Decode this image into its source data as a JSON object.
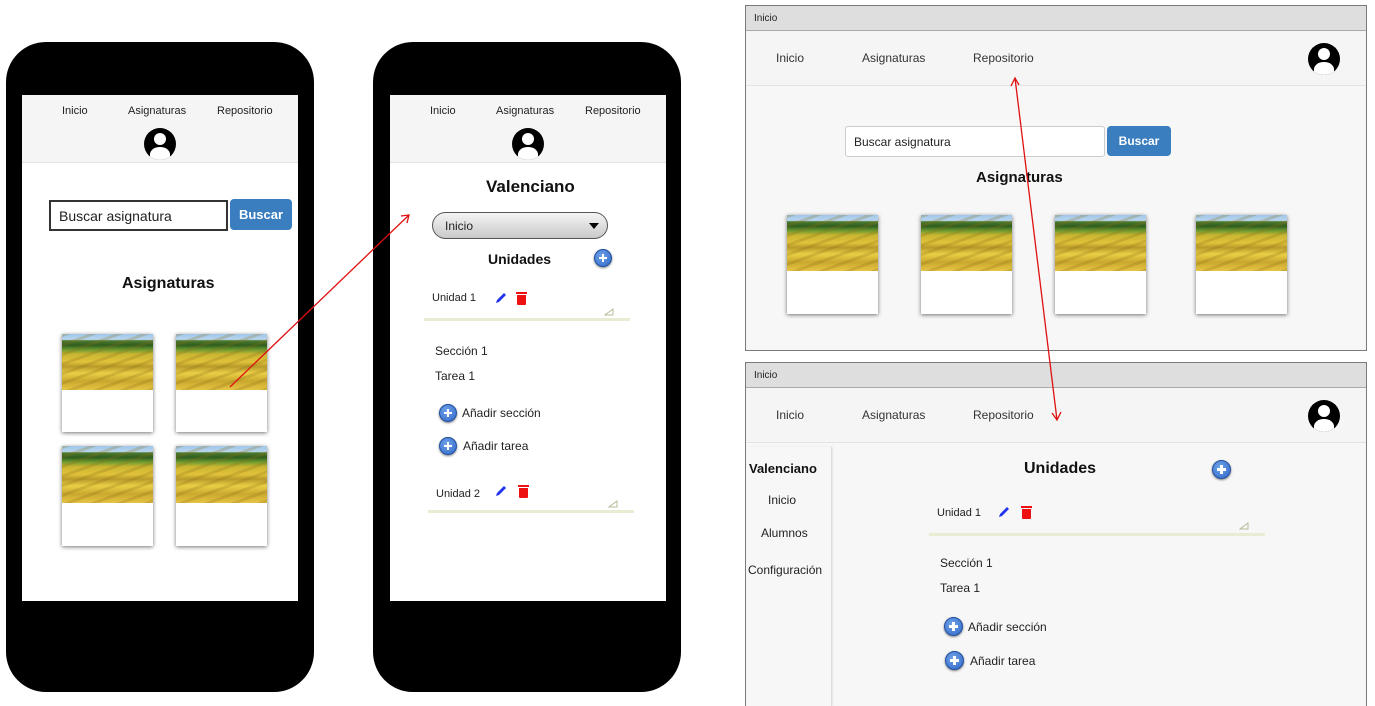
{
  "nav": {
    "inicio": "Inicio",
    "asignaturas": "Asignaturas",
    "repositorio": "Repositorio"
  },
  "search": {
    "placeholder": "Buscar asignatura",
    "button": "Buscar"
  },
  "home": {
    "title": "Asignaturas"
  },
  "course": {
    "title": "Valenciano",
    "select_value": "Inicio",
    "units_title": "Unidades",
    "unit1": "Unidad 1",
    "unit2": "Unidad 2",
    "section1": "Sección 1",
    "task1": "Tarea 1",
    "add_section": "Añadir sección",
    "add_task": "Añadir tarea"
  },
  "window": {
    "title_bar": "Inicio"
  },
  "sidebar": {
    "course": "Valenciano",
    "items": [
      "Inicio",
      "Alumnos",
      "Configuración"
    ]
  },
  "colors": {
    "primary_button": "#3a7ebf",
    "arrow": "#e01010",
    "delete": "#ee1111",
    "edit": "#2233ee"
  },
  "icons": [
    "avatar-icon",
    "plus-circle-icon",
    "pencil-icon",
    "trash-icon",
    "grip-icon",
    "dropdown-arrow-icon"
  ]
}
